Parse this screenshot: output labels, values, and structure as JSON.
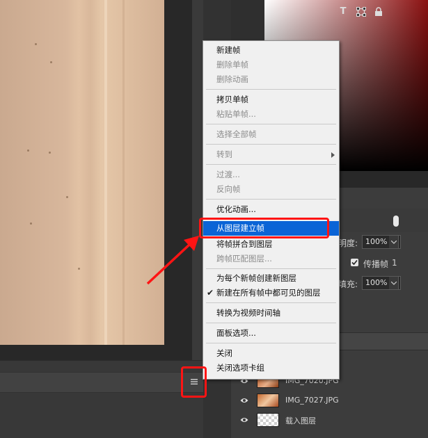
{
  "context_menu": {
    "items": [
      {
        "label": "新建帧",
        "enabled": true
      },
      {
        "label": "删除单帧",
        "enabled": false
      },
      {
        "label": "删除动画",
        "enabled": false
      },
      {
        "label": "拷贝单帧",
        "enabled": true
      },
      {
        "label": "粘贴单帧...",
        "enabled": false
      },
      {
        "label": "选择全部帧",
        "enabled": false
      },
      {
        "label": "转到",
        "enabled": false,
        "submenu": true
      },
      {
        "label": "过渡...",
        "enabled": false
      },
      {
        "label": "反向帧",
        "enabled": false
      },
      {
        "label": "优化动画...",
        "enabled": true
      },
      {
        "label": "从图层建立帧",
        "enabled": true,
        "highlighted": true
      },
      {
        "label": "将帧拼合到图层",
        "enabled": true
      },
      {
        "label": "跨帧匹配图层...",
        "enabled": false
      },
      {
        "label": "为每个新帧创建新图层",
        "enabled": true
      },
      {
        "label": "新建在所有帧中都可见的图层",
        "enabled": true,
        "checked": true
      },
      {
        "label": "转换为视频时间轴",
        "enabled": true
      },
      {
        "label": "面板选项...",
        "enabled": true
      },
      {
        "label": "关闭",
        "enabled": true
      },
      {
        "label": "关闭选项卡组",
        "enabled": true
      }
    ]
  },
  "layers_panel": {
    "opacity_label": "明度:",
    "opacity_value": "100%",
    "propagate_label": "传播帧",
    "propagate_value": "1",
    "fill_label": "填充:",
    "fill_value": "100%",
    "layers": [
      {
        "name": "IMG_7020.JPG",
        "visible": true,
        "thumb": "photo"
      },
      {
        "name": "IMG_7027.JPG",
        "visible": true,
        "thumb": "photo"
      },
      {
        "name": "载入图层",
        "visible": true,
        "thumb": "transparent"
      }
    ]
  },
  "icons": {
    "panel_menu": "hamburger-icon",
    "type_filter": "type-layer-icon",
    "transform_filter": "transform-icon",
    "lock": "lock-icon",
    "toggle": "filter-toggle-icon",
    "eye": "eye-icon",
    "check": "checkmark-icon",
    "submenu": "chevron-right-icon"
  },
  "colors": {
    "highlight": "#0a64d6",
    "annotation": "#ff1414",
    "panel_bg": "#3c3c3c",
    "menu_bg": "#f0f0f0"
  }
}
